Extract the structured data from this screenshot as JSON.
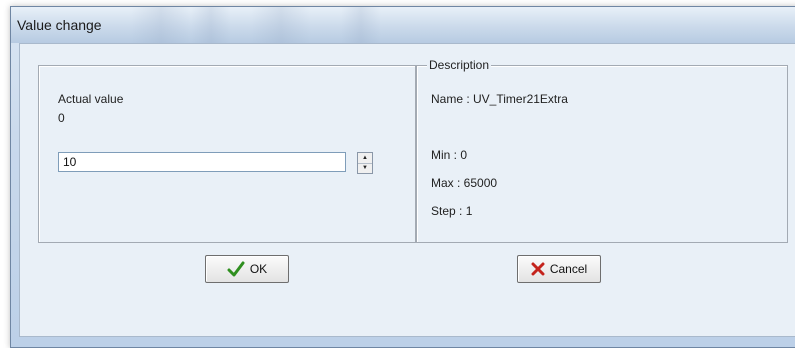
{
  "window": {
    "title": "Value change"
  },
  "actual": {
    "label": "Actual value",
    "value": "0"
  },
  "input": {
    "value": "10"
  },
  "description": {
    "group_label": "Description",
    "name": "Name : UV_Timer21Extra",
    "min": "Min : 0",
    "max": "Max : 65000",
    "step": "Step : 1"
  },
  "buttons": {
    "ok": "OK",
    "cancel": "Cancel"
  },
  "colors": {
    "ok_icon": "#2f8f1f",
    "cancel_icon": "#c4231c",
    "window_bg": "#e9f0f7"
  }
}
